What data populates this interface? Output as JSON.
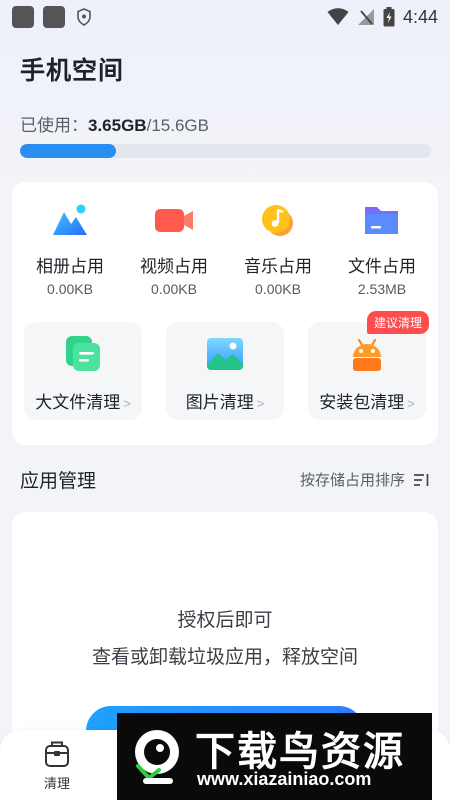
{
  "status_bar": {
    "time": "4:44"
  },
  "page_title": "手机空间",
  "storage": {
    "label": "已使用：",
    "used": "3.65GB",
    "total": "/15.6GB",
    "used_fraction": 0.234
  },
  "stats": [
    {
      "label": "相册占用",
      "value": "0.00KB",
      "icon": "album-icon"
    },
    {
      "label": "视频占用",
      "value": "0.00KB",
      "icon": "video-icon"
    },
    {
      "label": "音乐占用",
      "value": "0.00KB",
      "icon": "music-icon"
    },
    {
      "label": "文件占用",
      "value": "2.53MB",
      "icon": "folder-icon"
    }
  ],
  "tools": [
    {
      "label": "大文件清理",
      "icon": "large-file-icon"
    },
    {
      "label": "图片清理",
      "icon": "image-icon"
    },
    {
      "label": "安装包清理",
      "icon": "android-package-icon",
      "badge": "建议清理"
    }
  ],
  "app_section": {
    "title": "应用管理",
    "sort_label": "按存储占用排序"
  },
  "empty_state": {
    "line1": "授权后即可",
    "line2": "查看或卸载垃圾应用，释放空间"
  },
  "bottom_nav": [
    {
      "label": "清理",
      "icon": "clean-icon"
    }
  ],
  "watermark": {
    "title": "下载鸟资源",
    "url": "www.xiazainiao.com"
  },
  "colors": {
    "accent": "#2a8ef0",
    "badge": "#ff4d4f",
    "background": "#f3f4f8"
  }
}
